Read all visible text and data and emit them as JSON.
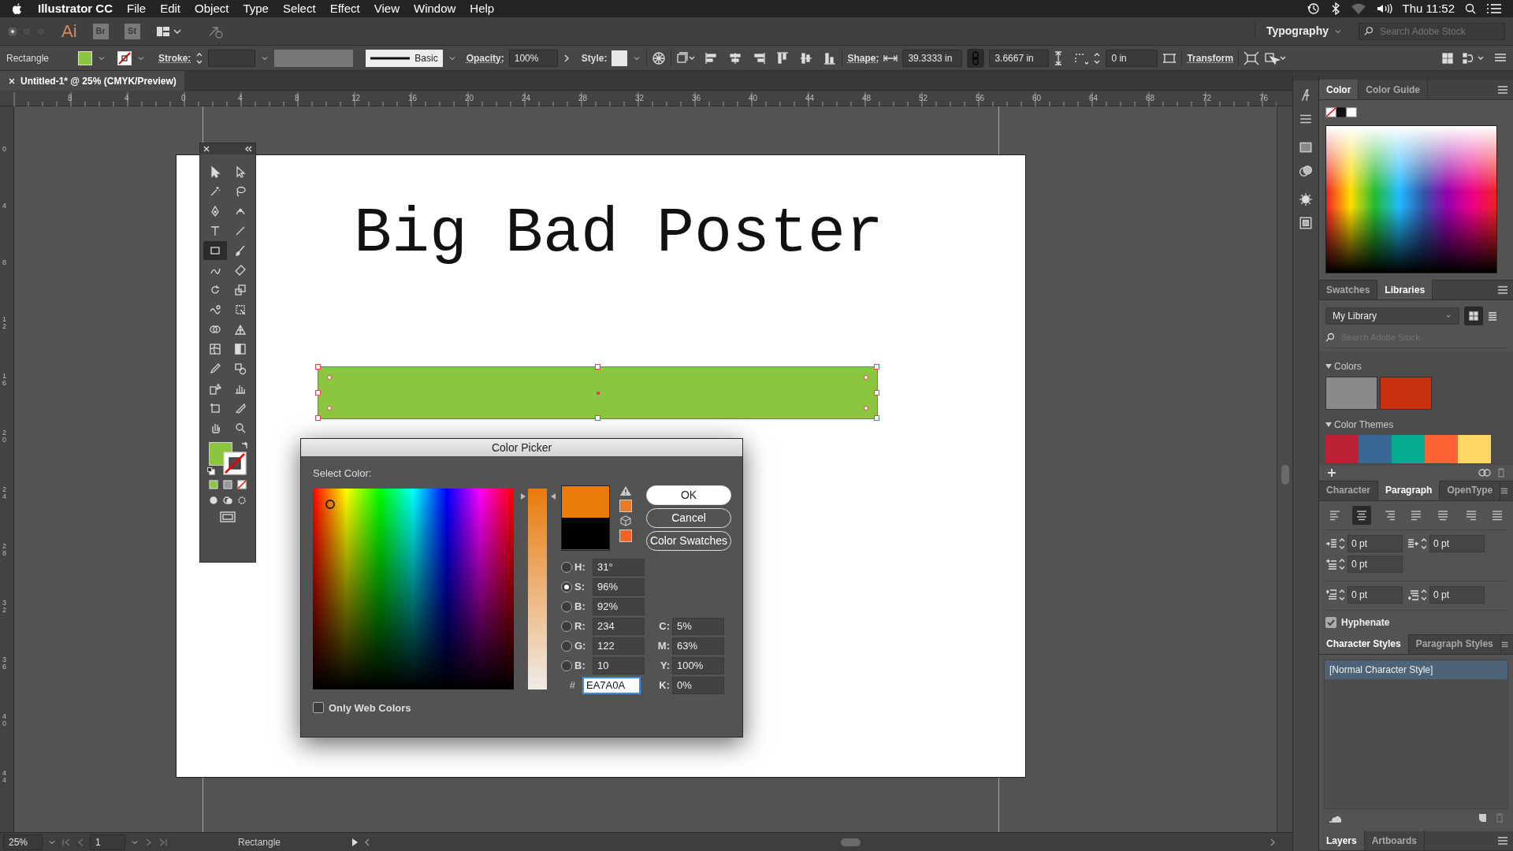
{
  "menu_bar": {
    "app": "Illustrator CC",
    "items": [
      "File",
      "Edit",
      "Object",
      "Type",
      "Select",
      "Effect",
      "View",
      "Window",
      "Help"
    ],
    "clock": "Thu 11:52"
  },
  "app_bar": {
    "logo": "Ai",
    "apps": [
      "Br",
      "St"
    ],
    "workspace": "Typography",
    "search": {
      "placeholder": "Search Adobe Stock"
    }
  },
  "control_bar": {
    "selection": "Rectangle",
    "fill": {
      "color": "#8cc63f"
    },
    "stroke_label": "Stroke:",
    "brush": "Basic",
    "opacity_label": "Opacity:",
    "opacity": "100%",
    "style_label": "Style:",
    "shape_label": "Shape:",
    "width": "39.3333 in",
    "height": "3.6667 in",
    "corner": "0 in",
    "transform": "Transform"
  },
  "document_tab": {
    "title": "Untitled-1* @ 25% (CMYK/Preview)"
  },
  "ruler": {
    "horizontal": [
      "8",
      "4",
      "0",
      "4",
      "8",
      "12",
      "16",
      "20",
      "24",
      "28",
      "32",
      "36",
      "40",
      "44",
      "48",
      "52",
      "56",
      "60",
      "64",
      "68",
      "72",
      "76"
    ],
    "vertical": [
      "0",
      "4",
      "8",
      "12",
      "16",
      "20",
      "24",
      "28",
      "32",
      "36",
      "40",
      "44"
    ]
  },
  "artboard": {
    "title": "Big Bad Poster",
    "rectangle": {
      "color": "#8cc63f",
      "selected": true
    }
  },
  "tools": [
    {
      "kind": "select",
      "selected": false
    },
    {
      "kind": "direct",
      "selected": false
    },
    {
      "kind": "wand",
      "selected": false
    },
    {
      "kind": "lasso",
      "selected": false
    },
    {
      "kind": "pen",
      "selected": false
    },
    {
      "kind": "curvature",
      "selected": false
    },
    {
      "kind": "type",
      "selected": false
    },
    {
      "kind": "line",
      "selected": false
    },
    {
      "kind": "rect",
      "selected": true
    },
    {
      "kind": "brush",
      "selected": false
    },
    {
      "kind": "shaper",
      "selected": false
    },
    {
      "kind": "eraser",
      "selected": false
    },
    {
      "kind": "rotate",
      "selected": false
    },
    {
      "kind": "scale",
      "selected": false
    },
    {
      "kind": "warp",
      "selected": false
    },
    {
      "kind": "free",
      "selected": false
    },
    {
      "kind": "builder",
      "selected": false
    },
    {
      "kind": "persp",
      "selected": false
    },
    {
      "kind": "mesh",
      "selected": false
    },
    {
      "kind": "gradient",
      "selected": false
    },
    {
      "kind": "eyedrop",
      "selected": false
    },
    {
      "kind": "blend",
      "selected": false
    },
    {
      "kind": "symbol",
      "selected": false
    },
    {
      "kind": "graph",
      "selected": false
    },
    {
      "kind": "artboard",
      "selected": false
    },
    {
      "kind": "slice",
      "selected": false
    },
    {
      "kind": "hand",
      "selected": false
    },
    {
      "kind": "zoom",
      "selected": false
    }
  ],
  "color_picker": {
    "title": "Color Picker",
    "label": "Select Color:",
    "new_swatch": {
      "color": "#ea7a0a"
    },
    "current_swatch": {
      "color": "#000000"
    },
    "gamut_swatch": {
      "color": "#e87a2a"
    },
    "web_swatch": {
      "color": "#f26522"
    },
    "saturation_slider": {
      "level": 0.96
    },
    "buttons": [
      {
        "label": "OK",
        "default": true
      },
      {
        "label": "Cancel",
        "default": false
      },
      {
        "label": "Color Swatches",
        "default": false
      }
    ],
    "hsb_rgb": [
      {
        "label": "H:",
        "value": "31°",
        "selected": false
      },
      {
        "label": "S:",
        "value": "96%",
        "selected": true
      },
      {
        "label": "B:",
        "value": "92%",
        "selected": false
      },
      {
        "label": "R:",
        "value": "234",
        "selected": false
      },
      {
        "label": "G:",
        "value": "122",
        "selected": false
      },
      {
        "label": "B:",
        "value": "10",
        "selected": false
      }
    ],
    "cmyk": [
      {
        "label": "C:",
        "value": "5%"
      },
      {
        "label": "M:",
        "value": "63%"
      },
      {
        "label": "Y:",
        "value": "100%"
      },
      {
        "label": "K:",
        "value": "0%"
      }
    ],
    "hex": {
      "label": "#",
      "value": "EA7A0A"
    },
    "only_web_colors": {
      "label": "Only Web Colors",
      "checked": false
    }
  },
  "color_panel": {
    "tabs": [
      {
        "label": "Color",
        "selected": true
      },
      {
        "label": "Color Guide",
        "selected": false
      }
    ]
  },
  "libraries_panel": {
    "tabs": [
      {
        "label": "Swatches",
        "selected": false
      },
      {
        "label": "Libraries",
        "selected": true
      }
    ],
    "library": "My Library",
    "search": {
      "placeholder": "Search Adobe Stock"
    },
    "colors": {
      "label": "Colors",
      "items": [
        {
          "color": "#8a8a8a"
        },
        {
          "color": "#c8300f"
        }
      ]
    },
    "themes": {
      "label": "Color Themes",
      "items": [
        {
          "color": "#bc2034"
        },
        {
          "color": "#366a94"
        },
        {
          "color": "#05ab8f"
        },
        {
          "color": "#fc6334"
        },
        {
          "color": "#fed663"
        }
      ]
    }
  },
  "paragraph_panel": {
    "tabs": [
      {
        "label": "Character",
        "selected": false
      },
      {
        "label": "Paragraph",
        "selected": true
      },
      {
        "label": "OpenType",
        "selected": false
      }
    ],
    "alignment": [
      {
        "kind": "left",
        "selected": false
      },
      {
        "kind": "center",
        "selected": true
      },
      {
        "kind": "right",
        "selected": false
      },
      {
        "kind": "justify-left",
        "selected": false
      },
      {
        "kind": "justify-center",
        "selected": false
      },
      {
        "kind": "justify-right",
        "selected": false
      },
      {
        "kind": "justify-all",
        "selected": false
      }
    ],
    "fields": [
      {
        "kind": "left-indent",
        "value": "0 pt"
      },
      {
        "kind": "right-indent",
        "value": "0 pt"
      },
      {
        "kind": "first-line",
        "value": "0 pt"
      },
      {
        "kind": "space-before",
        "value": "0 pt"
      },
      {
        "kind": "space-after",
        "value": "0 pt"
      }
    ],
    "hyphenate": {
      "label": "Hyphenate",
      "checked": true
    }
  },
  "styles_panel": {
    "tabs": [
      {
        "label": "Character Styles",
        "selected": true
      },
      {
        "label": "Paragraph Styles",
        "selected": false
      }
    ],
    "items": [
      {
        "label": "[Normal Character Style]",
        "selected": true
      }
    ]
  },
  "layers_panel": {
    "tabs": [
      {
        "label": "Layers",
        "selected": true
      },
      {
        "label": "Artboards",
        "selected": false
      }
    ]
  },
  "status_bar": {
    "zoom": "25%",
    "artboard": "1",
    "tool": "Rectangle"
  }
}
